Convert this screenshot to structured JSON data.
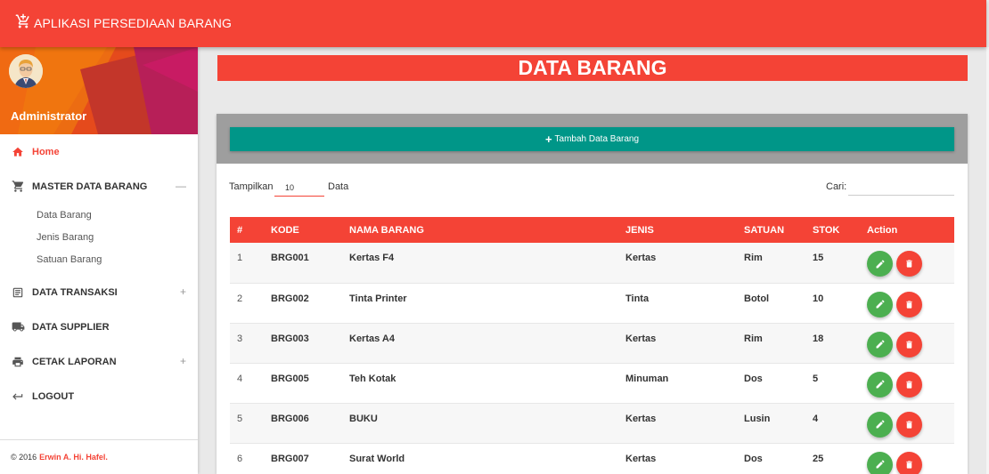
{
  "header": {
    "title": "APLIKASI PERSEDIAAN BARANG"
  },
  "colors": {
    "primary": "#f44336",
    "accent": "#009688",
    "edit": "#4caf50",
    "delete": "#f44336"
  },
  "user": {
    "name": "Administrator"
  },
  "sidebar": {
    "items": [
      {
        "label": "Home",
        "icon": "home-icon",
        "toggle": ""
      },
      {
        "label": "MASTER DATA BARANG",
        "icon": "cart-icon",
        "toggle": "—"
      },
      {
        "label": "DATA TRANSAKSI",
        "icon": "transaction-icon",
        "toggle": "+"
      },
      {
        "label": "DATA SUPPLIER",
        "icon": "truck-icon",
        "toggle": ""
      },
      {
        "label": "CETAK LAPORAN",
        "icon": "print-icon",
        "toggle": "+"
      },
      {
        "label": "LOGOUT",
        "icon": "logout-icon",
        "toggle": ""
      }
    ],
    "submenu": [
      "Data Barang",
      "Jenis Barang",
      "Satuan Barang"
    ],
    "footer": {
      "prefix": "© 2016",
      "author": "Erwin A. Hi. Hafel."
    }
  },
  "page": {
    "title": "DATA BARANG",
    "add_button": "Tambah Data Barang",
    "show_label": "Tampilkan",
    "show_value": "10",
    "data_label": "Data",
    "search_label": "Cari:",
    "search_value": ""
  },
  "table": {
    "headers": [
      "#",
      "KODE",
      "NAMA BARANG",
      "JENIS",
      "SATUAN",
      "STOK",
      "Action"
    ],
    "rows": [
      [
        "1",
        "BRG001",
        "Kertas F4",
        "Kertas",
        "Rim",
        "15"
      ],
      [
        "2",
        "BRG002",
        "Tinta Printer",
        "Tinta",
        "Botol",
        "10"
      ],
      [
        "3",
        "BRG003",
        "Kertas A4",
        "Kertas",
        "Rim",
        "18"
      ],
      [
        "4",
        "BRG005",
        "Teh Kotak",
        "Minuman",
        "Dos",
        "5"
      ],
      [
        "5",
        "BRG006",
        "BUKU",
        "Kertas",
        "Lusin",
        "4"
      ],
      [
        "6",
        "BRG007",
        "Surat World",
        "Kertas",
        "Dos",
        "25"
      ]
    ]
  }
}
